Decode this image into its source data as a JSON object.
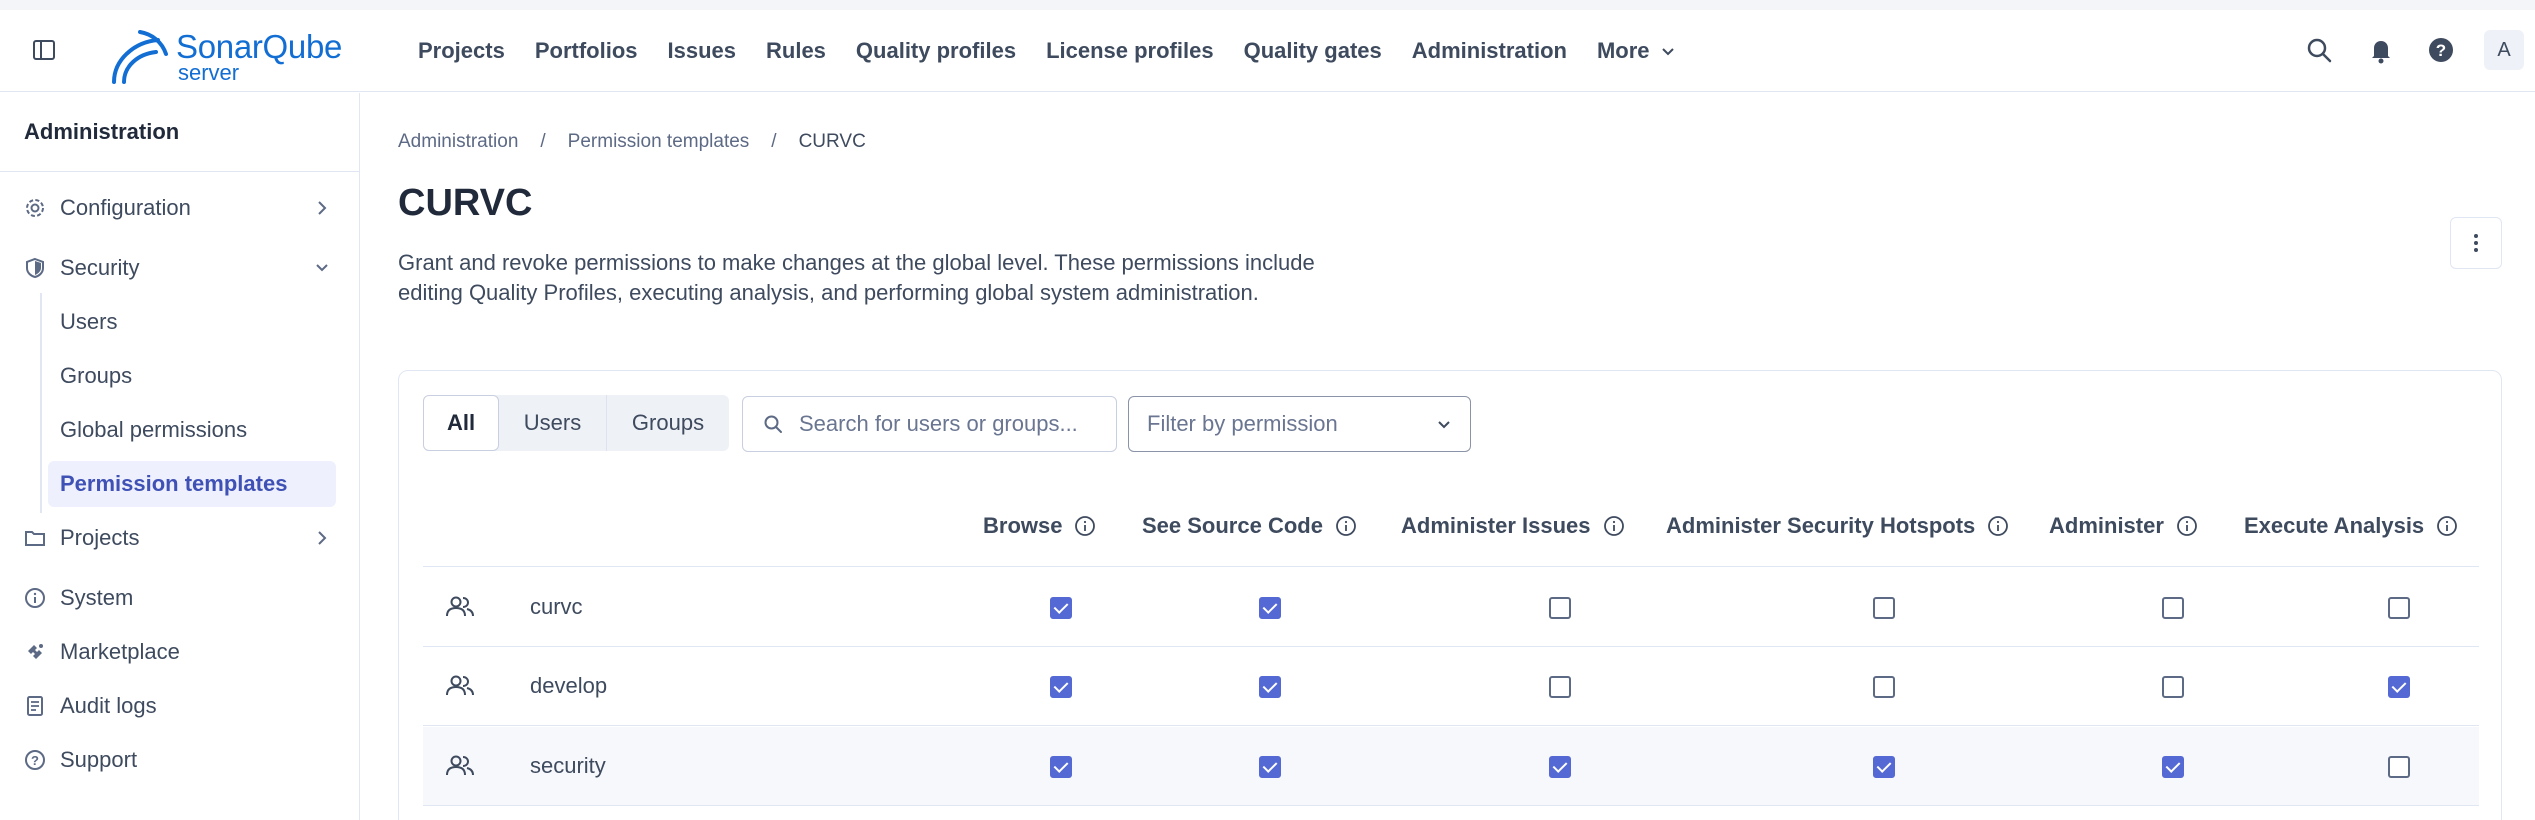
{
  "topnav": {
    "logo_text": "SonarQube",
    "logo_sub": "server",
    "items": [
      "Projects",
      "Portfolios",
      "Issues",
      "Rules",
      "Quality profiles",
      "License profiles",
      "Quality gates",
      "Administration"
    ],
    "more_label": "More",
    "avatar_letter": "A",
    "icons": [
      "search-icon",
      "bell-icon",
      "help-icon"
    ]
  },
  "sidebar": {
    "title": "Administration",
    "items": {
      "configuration": "Configuration",
      "security": "Security",
      "projects": "Projects",
      "system": "System",
      "marketplace": "Marketplace",
      "audit_logs": "Audit logs",
      "support": "Support"
    },
    "security_sub": [
      "Users",
      "Groups",
      "Global permissions",
      "Permission templates"
    ],
    "active_sub": "Permission templates"
  },
  "breadcrumb": [
    "Administration",
    "Permission templates",
    "CURVC"
  ],
  "page": {
    "title": "CURVC",
    "description_line1": "Grant and revoke permissions to make changes at the global level. These permissions include",
    "description_line2": "editing Quality Profiles, executing analysis, and performing global system administration."
  },
  "filters": {
    "segments": [
      "All",
      "Users",
      "Groups"
    ],
    "selected_segment": "All",
    "search_placeholder": "Search for users or groups...",
    "permission_placeholder": "Filter by permission"
  },
  "table": {
    "columns": [
      "Browse",
      "See Source Code",
      "Administer Issues",
      "Administer Security Hotspots",
      "Administer",
      "Execute Analysis"
    ],
    "rows": [
      {
        "name": "curvc",
        "type": "group",
        "perms": [
          true,
          true,
          false,
          false,
          false,
          false
        ]
      },
      {
        "name": "develop",
        "type": "group",
        "perms": [
          true,
          true,
          false,
          false,
          false,
          true
        ]
      },
      {
        "name": "security",
        "type": "group",
        "perms": [
          true,
          true,
          true,
          true,
          true,
          false
        ]
      }
    ]
  },
  "colors": {
    "brand": "#126ed3",
    "accent": "#5469d4",
    "active_bg": "#eef1fd"
  }
}
